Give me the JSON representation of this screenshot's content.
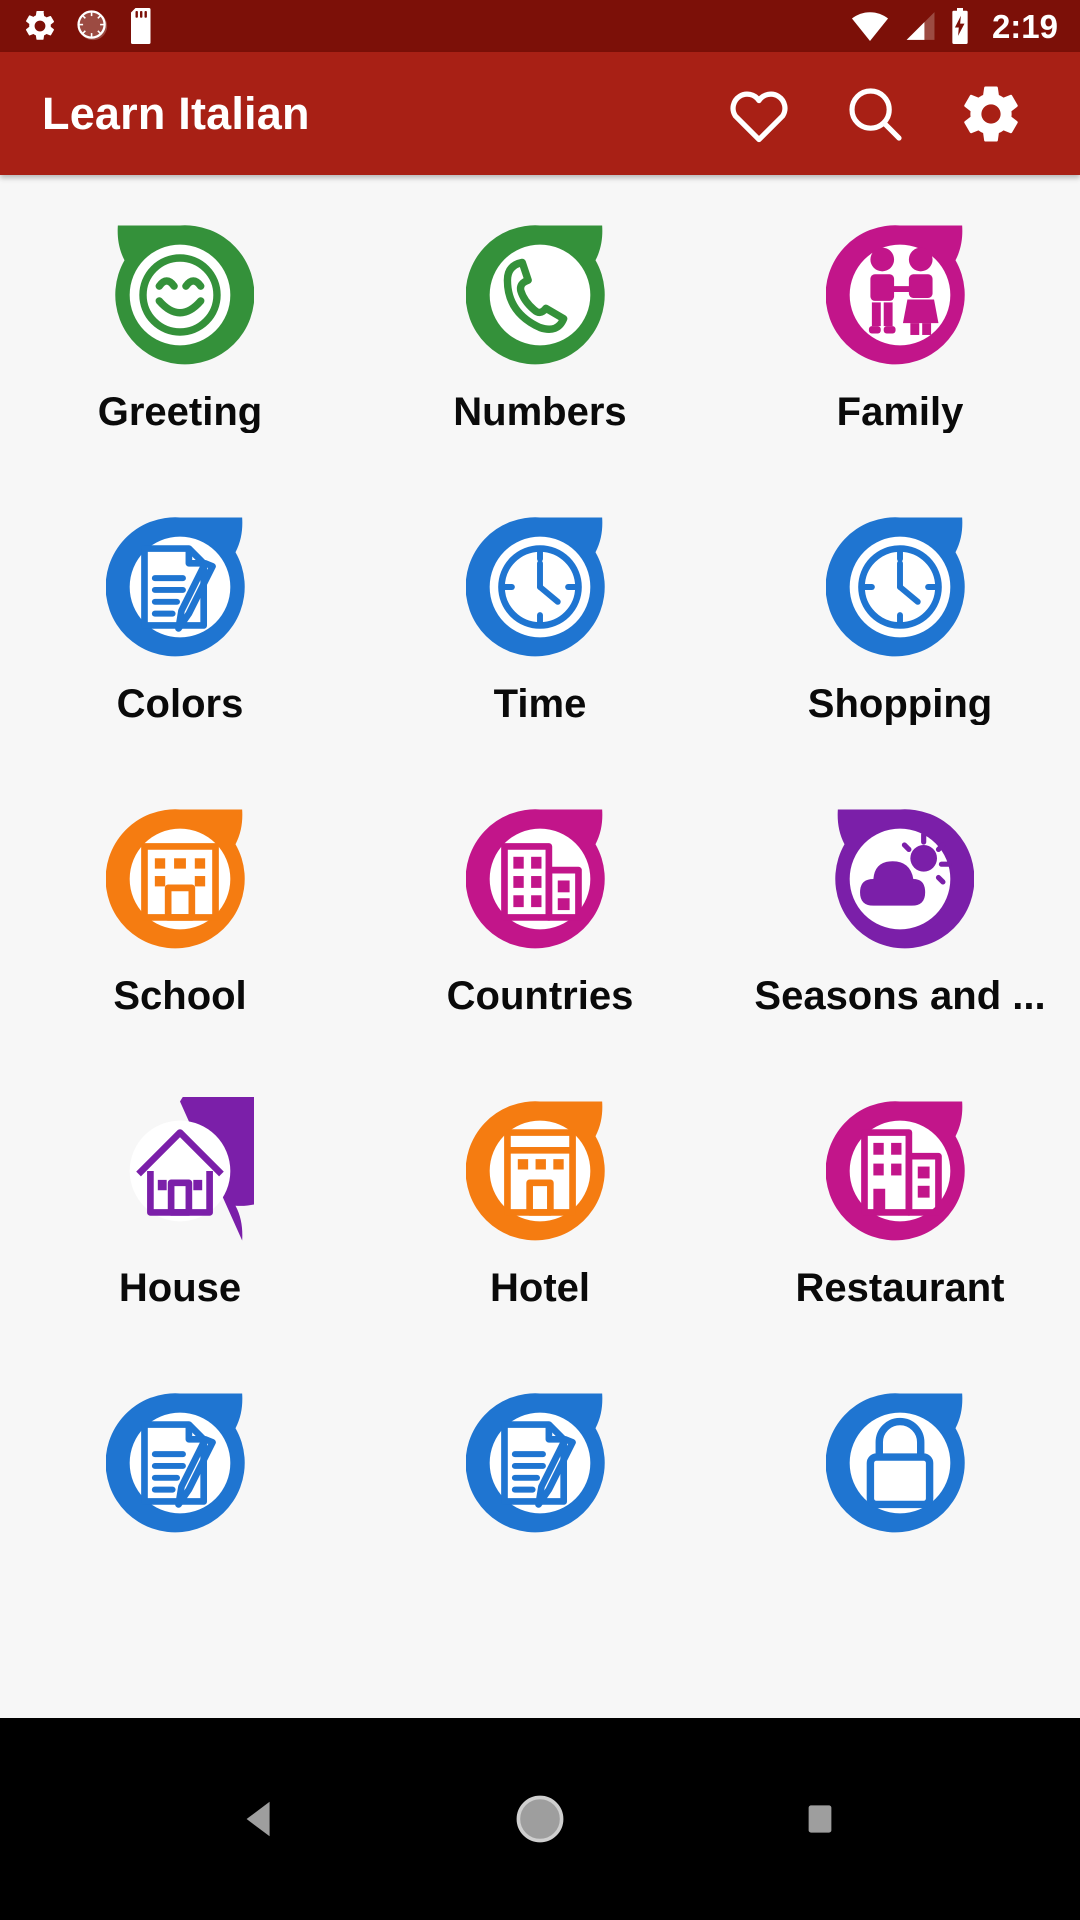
{
  "statusbar": {
    "time": "2:19",
    "left_icons": [
      "settings-gear-icon",
      "sync-circle-icon",
      "sd-card-icon"
    ],
    "right_icons": [
      "wifi-icon",
      "cellular-signal-icon",
      "battery-charging-icon"
    ],
    "background": "#7c1008"
  },
  "appbar": {
    "title": "Learn Italian",
    "background": "#a82015",
    "actions": [
      {
        "name": "favorites-button",
        "icon": "heart-icon",
        "label": "Favorites"
      },
      {
        "name": "search-button",
        "icon": "search-icon",
        "label": "Search"
      },
      {
        "name": "settings-button",
        "icon": "gear-icon",
        "label": "Settings"
      }
    ]
  },
  "grid": {
    "background": "#f7f7f7",
    "columns": 3,
    "items": [
      {
        "label": "Greeting",
        "color": "#34913a",
        "icon": "smiley-face-icon",
        "tail": "top-left"
      },
      {
        "label": "Numbers",
        "color": "#34913a",
        "icon": "phone-icon",
        "tail": "top-right"
      },
      {
        "label": "Family",
        "color": "#c2158a",
        "icon": "family-couple-icon",
        "tail": "top-right"
      },
      {
        "label": "Colors",
        "color": "#1f75d1",
        "icon": "notepad-pencil-icon",
        "tail": "top-right"
      },
      {
        "label": "Time",
        "color": "#1f75d1",
        "icon": "clock-icon",
        "tail": "top-right"
      },
      {
        "label": "Shopping",
        "color": "#1f75d1",
        "icon": "clock-icon",
        "tail": "top-right"
      },
      {
        "label": "School",
        "color": "#f57c11",
        "icon": "school-building-icon",
        "tail": "top-right"
      },
      {
        "label": "Countries",
        "color": "#c2158a",
        "icon": "city-buildings-icon",
        "tail": "top-right"
      },
      {
        "label": "Seasons and ...",
        "color": "#7b1fa9",
        "icon": "weather-cloud-sun-icon",
        "tail": "top-left"
      },
      {
        "label": "House",
        "color": "#7b1fa9",
        "icon": "house-icon",
        "tail": "bottom-right"
      },
      {
        "label": "Hotel",
        "color": "#f57c11",
        "icon": "hotel-building-icon",
        "tail": "top-right"
      },
      {
        "label": "Restaurant",
        "color": "#c2158a",
        "icon": "restaurant-building-icon",
        "tail": "top-right"
      },
      {
        "label": "",
        "color": "#1f75d1",
        "icon": "notepad-pencil-icon",
        "tail": "top-right"
      },
      {
        "label": "",
        "color": "#1f75d1",
        "icon": "notepad-pencil-icon",
        "tail": "top-right"
      },
      {
        "label": "",
        "color": "#1f75d1",
        "icon": "lock-icon",
        "tail": "top-right"
      }
    ]
  },
  "navbar": {
    "background": "#000000",
    "buttons": [
      {
        "name": "back-button",
        "icon": "triangle-back-icon",
        "label": "Back"
      },
      {
        "name": "home-button",
        "icon": "circle-home-icon",
        "label": "Home"
      },
      {
        "name": "recents-button",
        "icon": "square-recents-icon",
        "label": "Recent apps"
      }
    ]
  }
}
